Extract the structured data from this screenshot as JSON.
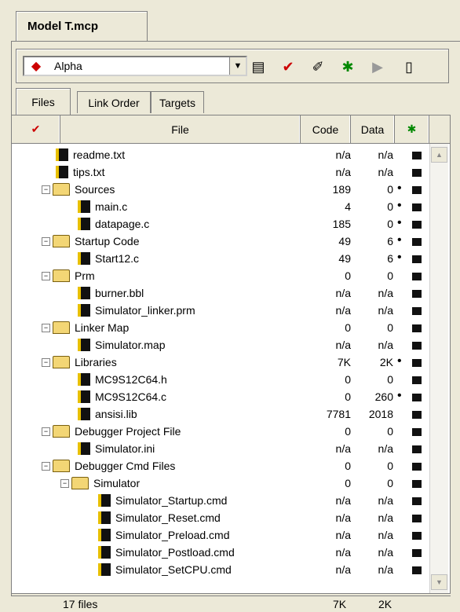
{
  "window": {
    "tab_title": "Model T.mcp"
  },
  "toolbar": {
    "target": "Alpha",
    "icons": [
      "target-settings-icon",
      "check-icon",
      "make-icon",
      "debug-icon",
      "run-icon",
      "project-inspector-icon"
    ]
  },
  "tabs": [
    {
      "label": "Files"
    },
    {
      "label": "Link Order"
    },
    {
      "label": "Targets"
    }
  ],
  "columns": {
    "file": "File",
    "code": "Code",
    "data": "Data"
  },
  "rows": [
    {
      "name": "readme.txt",
      "type": "file",
      "code": "n/a",
      "data": "n/a",
      "dot": ""
    },
    {
      "name": "tips.txt",
      "type": "file",
      "code": "n/a",
      "data": "n/a",
      "dot": ""
    },
    {
      "name": "Sources",
      "type": "folder",
      "code": "189",
      "data": "0",
      "dot": "•"
    },
    {
      "name": "main.c",
      "type": "file",
      "code": "4",
      "data": "0",
      "dot": "•"
    },
    {
      "name": "datapage.c",
      "type": "file",
      "code": "185",
      "data": "0",
      "dot": "•"
    },
    {
      "name": "Startup Code",
      "type": "folder",
      "code": "49",
      "data": "6",
      "dot": "•"
    },
    {
      "name": "Start12.c",
      "type": "file",
      "code": "49",
      "data": "6",
      "dot": "•"
    },
    {
      "name": "Prm",
      "type": "folder",
      "code": "0",
      "data": "0",
      "dot": ""
    },
    {
      "name": "burner.bbl",
      "type": "file",
      "code": "n/a",
      "data": "n/a",
      "dot": ""
    },
    {
      "name": "Simulator_linker.prm",
      "type": "file",
      "code": "n/a",
      "data": "n/a",
      "dot": ""
    },
    {
      "name": "Linker Map",
      "type": "folder",
      "code": "0",
      "data": "0",
      "dot": ""
    },
    {
      "name": "Simulator.map",
      "type": "file",
      "code": "n/a",
      "data": "n/a",
      "dot": ""
    },
    {
      "name": "Libraries",
      "type": "folder",
      "code": "7K",
      "data": "2K",
      "dot": "•"
    },
    {
      "name": "MC9S12C64.h",
      "type": "file",
      "code": "0",
      "data": "0",
      "dot": ""
    },
    {
      "name": "MC9S12C64.c",
      "type": "file",
      "code": "0",
      "data": "260",
      "dot": "•"
    },
    {
      "name": "ansisi.lib",
      "type": "file",
      "code": "7781",
      "data": "2018",
      "dot": ""
    },
    {
      "name": "Debugger Project File",
      "type": "folder",
      "code": "0",
      "data": "0",
      "dot": ""
    },
    {
      "name": "Simulator.ini",
      "type": "file",
      "code": "n/a",
      "data": "n/a",
      "dot": ""
    },
    {
      "name": "Debugger Cmd Files",
      "type": "folder",
      "code": "0",
      "data": "0",
      "dot": ""
    },
    {
      "name": "Simulator",
      "type": "folder",
      "code": "0",
      "data": "0",
      "dot": ""
    },
    {
      "name": "Simulator_Startup.cmd",
      "type": "file",
      "code": "n/a",
      "data": "n/a",
      "dot": ""
    },
    {
      "name": "Simulator_Reset.cmd",
      "type": "file",
      "code": "n/a",
      "data": "n/a",
      "dot": ""
    },
    {
      "name": "Simulator_Preload.cmd",
      "type": "file",
      "code": "n/a",
      "data": "n/a",
      "dot": ""
    },
    {
      "name": "Simulator_Postload.cmd",
      "type": "file",
      "code": "n/a",
      "data": "n/a",
      "dot": ""
    },
    {
      "name": "Simulator_SetCPU.cmd",
      "type": "file",
      "code": "n/a",
      "data": "n/a",
      "dot": ""
    }
  ],
  "status": {
    "files": "17 files",
    "code": "7K",
    "data": "2K"
  }
}
